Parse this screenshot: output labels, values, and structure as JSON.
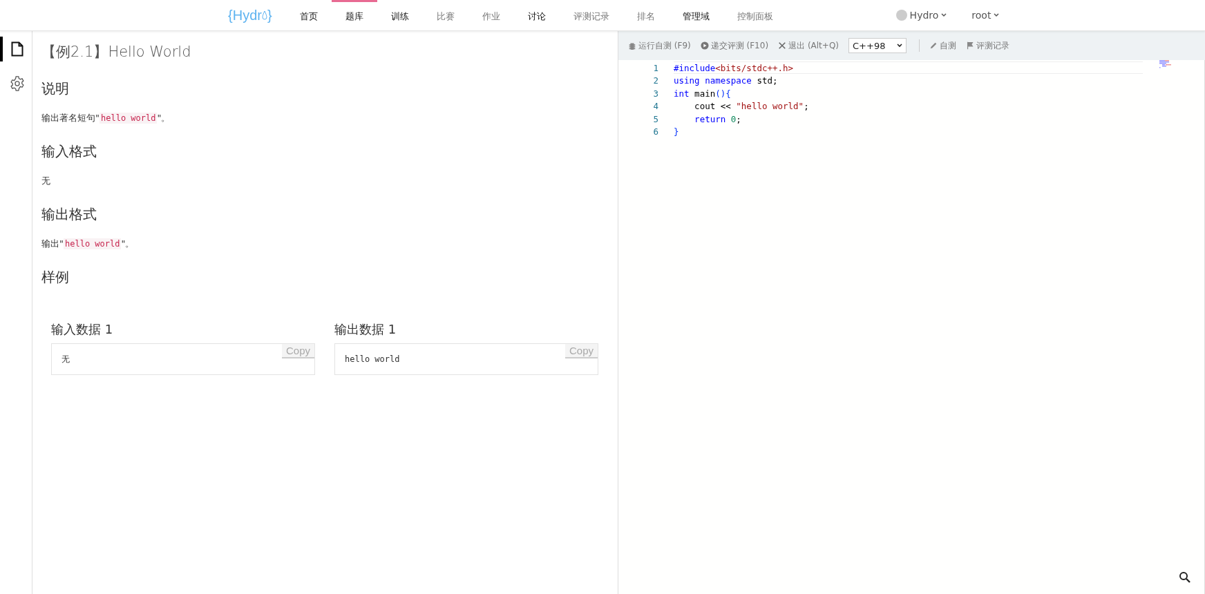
{
  "nav": {
    "logo": {
      "left": "{",
      "name": "Hydr",
      "right": "}"
    },
    "items": [
      {
        "label": "首页",
        "selected": false,
        "bold": true
      },
      {
        "label": "题库",
        "selected": true,
        "bold": true
      },
      {
        "label": "训练",
        "selected": false,
        "bold": true
      },
      {
        "label": "比赛",
        "selected": false,
        "bold": false
      },
      {
        "label": "作业",
        "selected": false,
        "bold": false
      },
      {
        "label": "讨论",
        "selected": false,
        "bold": true
      },
      {
        "label": "评测记录",
        "selected": false,
        "bold": false
      },
      {
        "label": "排名",
        "selected": false,
        "bold": false
      },
      {
        "label": "管理域",
        "selected": false,
        "bold": true
      },
      {
        "label": "控制面板",
        "selected": false,
        "bold": false
      }
    ],
    "domain": "Hydro",
    "user": "root"
  },
  "side_tabs": [
    {
      "kind": "file",
      "selected": true
    },
    {
      "kind": "settings",
      "selected": false
    }
  ],
  "problem": {
    "title": "【例2.1】Hello World",
    "sections": [
      {
        "heading": "说明",
        "body": [
          {
            "kind": "text",
            "text": "输出著名短句\""
          },
          {
            "kind": "code",
            "text": "hello world"
          },
          {
            "kind": "text",
            "text": "\"。"
          }
        ]
      },
      {
        "heading": "输入格式",
        "body": [
          {
            "kind": "text",
            "text": "无"
          }
        ]
      },
      {
        "heading": "输出格式",
        "body": [
          {
            "kind": "text",
            "text": "输出\""
          },
          {
            "kind": "code",
            "text": "hello world"
          },
          {
            "kind": "text",
            "text": "\"。"
          }
        ]
      }
    ],
    "samples_heading": "样例",
    "samples": [
      {
        "title": "输入数据 1",
        "content": "无",
        "copy": "Copy"
      },
      {
        "title": "输出数据 1",
        "content": "hello world",
        "copy": "Copy"
      }
    ]
  },
  "editor": {
    "toolbar": [
      {
        "kind": "run",
        "label": "运行自测 (F9)"
      },
      {
        "kind": "submit",
        "label": "递交评测 (F10)"
      },
      {
        "kind": "exit",
        "label": "退出 (Alt+Q)"
      },
      {
        "kind": "select",
        "label": "C++98"
      },
      {
        "kind": "pretest",
        "label": "自测"
      },
      {
        "kind": "records",
        "label": "评测记录"
      }
    ],
    "lines": [
      {
        "number": "1",
        "active": true,
        "tokens": [
          {
            "kind": "directive",
            "text": "#include"
          },
          {
            "kind": "header",
            "text": "<bits/stdc++.h>"
          }
        ]
      },
      {
        "number": "2",
        "active": false,
        "tokens": [
          {
            "kind": "keyword",
            "text": "using "
          },
          {
            "kind": "keyword",
            "text": "namespace "
          },
          {
            "kind": "plain",
            "text": "std;"
          }
        ]
      },
      {
        "number": "3",
        "active": false,
        "tokens": [
          {
            "kind": "keyword",
            "text": "int"
          },
          {
            "kind": "plain",
            "text": " main"
          },
          {
            "kind": "bracket",
            "text": "(){"
          }
        ]
      },
      {
        "number": "4",
        "active": false,
        "tokens": [
          {
            "kind": "plain",
            "text": "    cout << "
          },
          {
            "kind": "string",
            "text": "\"hello world\""
          },
          {
            "kind": "plain",
            "text": ";"
          }
        ]
      },
      {
        "number": "5",
        "active": false,
        "tokens": [
          {
            "kind": "keyword",
            "text": "    return "
          },
          {
            "kind": "number",
            "text": "0"
          },
          {
            "kind": "plain",
            "text": ";"
          }
        ]
      },
      {
        "number": "6",
        "active": false,
        "tokens": [
          {
            "kind": "bracket",
            "text": "}"
          }
        ]
      }
    ]
  }
}
